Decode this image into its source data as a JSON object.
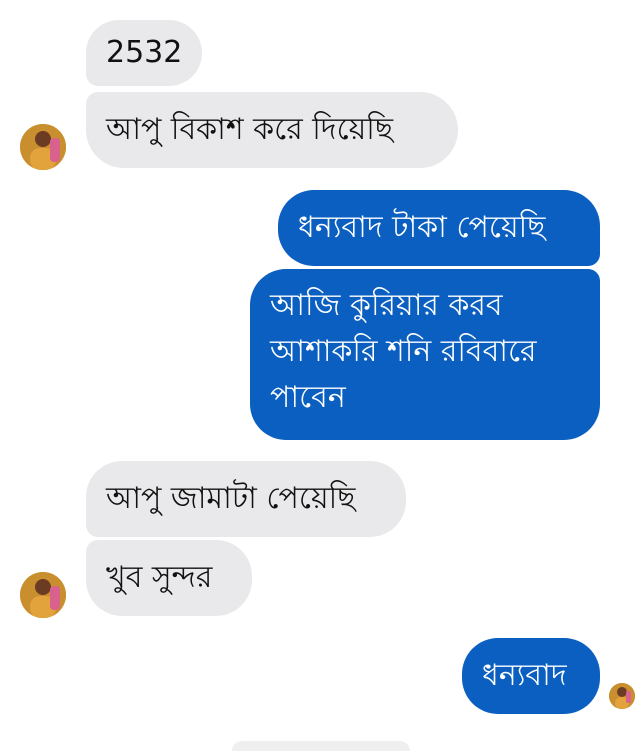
{
  "messages": [
    {
      "id": "m1",
      "side": "incoming",
      "text": "2532"
    },
    {
      "id": "m2",
      "side": "incoming",
      "text": "আপু বিকাশ করে দিয়েছি"
    },
    {
      "id": "m3",
      "side": "outgoing",
      "text": "ধন্যবাদ টাকা পেয়েছি"
    },
    {
      "id": "m4",
      "side": "outgoing",
      "lines": [
        "আজি কুরিয়ার করব",
        "আশাকরি শনি রবিবারে",
        "পাবেন"
      ]
    },
    {
      "id": "m5",
      "side": "incoming",
      "text": "আপু জামাটা পেয়েছি"
    },
    {
      "id": "m6",
      "side": "incoming",
      "text": "খুব সুন্দর"
    },
    {
      "id": "m7",
      "side": "outgoing",
      "text": "ধন্যবাদ"
    }
  ],
  "colors": {
    "incoming_bubble": "#e9e9eb",
    "outgoing_bubble": "#0a5fc0",
    "outgoing_text": "#ffffff",
    "incoming_text": "#111111"
  },
  "icons": {
    "contact_avatar": "contact-avatar-icon",
    "seen_avatar": "seen-receipt-avatar-icon"
  }
}
